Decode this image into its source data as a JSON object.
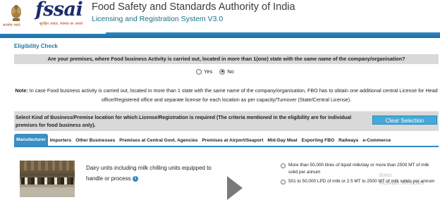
{
  "header": {
    "emblem_caption": "सत्यमेव जयते",
    "logo_word": "fssai",
    "logo_tagline": "सुरक्षित आहार, स्वास्थ्य का आधार",
    "org_title": "Food Safety and Standards Authority of India",
    "system_title": "Licensing and Registration System V3.0"
  },
  "eligibility": {
    "section_title": "Eligibility Check",
    "question": "Are your premises, where Food business Activity is carried out, located in more than 1(one) state with the same name of the company/organisation?",
    "yes_label": "Yes",
    "no_label": "No",
    "selected": "No",
    "note_label": "Note:",
    "note_text": "In case Food business activity is carried out, located in more than 1 state with the same name of the company/organisation, FBO has to obtain one additional central License for Head office/Registered office and separate license for each location as per capacity/Turnover (State/Central License)."
  },
  "business_kind": {
    "prompt": "Select Kind of Business/Premise location for which License/Registration is required (The criteria mentioned in the eligibility are for individual premises for food business only).",
    "clear_button": "Clear Selection"
  },
  "tabs": [
    {
      "label": "Manufacturer",
      "active": true
    },
    {
      "label": "Importers",
      "active": false
    },
    {
      "label": "Other Businesses",
      "active": false
    },
    {
      "label": "Premises at Central Govt. Agencies",
      "active": false
    },
    {
      "label": "Premises at Airport/Seaport",
      "active": false
    },
    {
      "label": "Mid-Day Meal",
      "active": false
    },
    {
      "label": "Exporting FBO",
      "active": false
    },
    {
      "label": "Railways",
      "active": false
    },
    {
      "label": "e-Commerce",
      "active": false
    }
  ],
  "category": {
    "description": "Dairy units including milk chilling units equipped to handle or process",
    "info_icon": "i",
    "options": [
      {
        "text": "More than 50,000 litres of liquid milk/day or more than 2500 MT of milk solid per annum"
      },
      {
        "text": "501 to 50,000 LPD of milk or 2.5 MT to 2500 MT of milk solids per annum"
      }
    ]
  },
  "watermark": {
    "line1": "Activate Windows",
    "line2": "dows"
  }
}
